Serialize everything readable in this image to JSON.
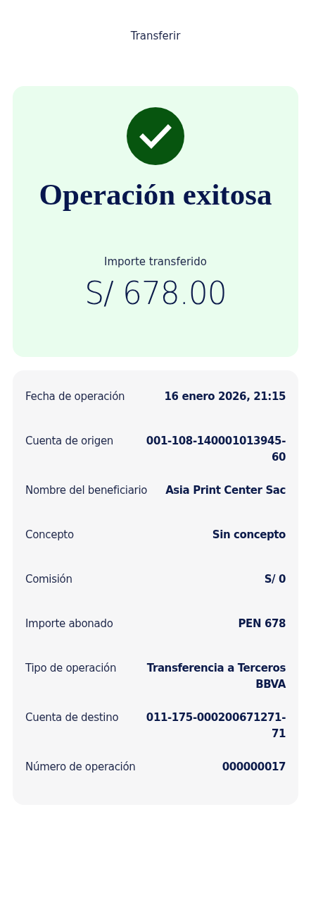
{
  "header": {
    "title": "Transferir"
  },
  "result": {
    "title": "Operación exitosa",
    "amount_label": "Importe transferido",
    "amount": "S/ 678.00"
  },
  "details": [
    {
      "label": "Fecha de operación",
      "value": "16 enero 2026, 21:15"
    },
    {
      "label": "Cuenta de origen",
      "value": "001-108-140001013945-60"
    },
    {
      "label": "Nombre del beneficiario",
      "value": "Asia Print Center Sac"
    },
    {
      "label": "Concepto",
      "value": "Sin concepto"
    },
    {
      "label": "Comisión",
      "value": "S/ 0"
    },
    {
      "label": "Importe abonado",
      "value": "PEN 678"
    },
    {
      "label": "Tipo de operación",
      "value": "Transferencia a Terceros BBVA"
    },
    {
      "label": "Cuenta de destino",
      "value": "011-175-000200671271-71"
    },
    {
      "label": "Número de operación",
      "value": "000000017"
    }
  ]
}
